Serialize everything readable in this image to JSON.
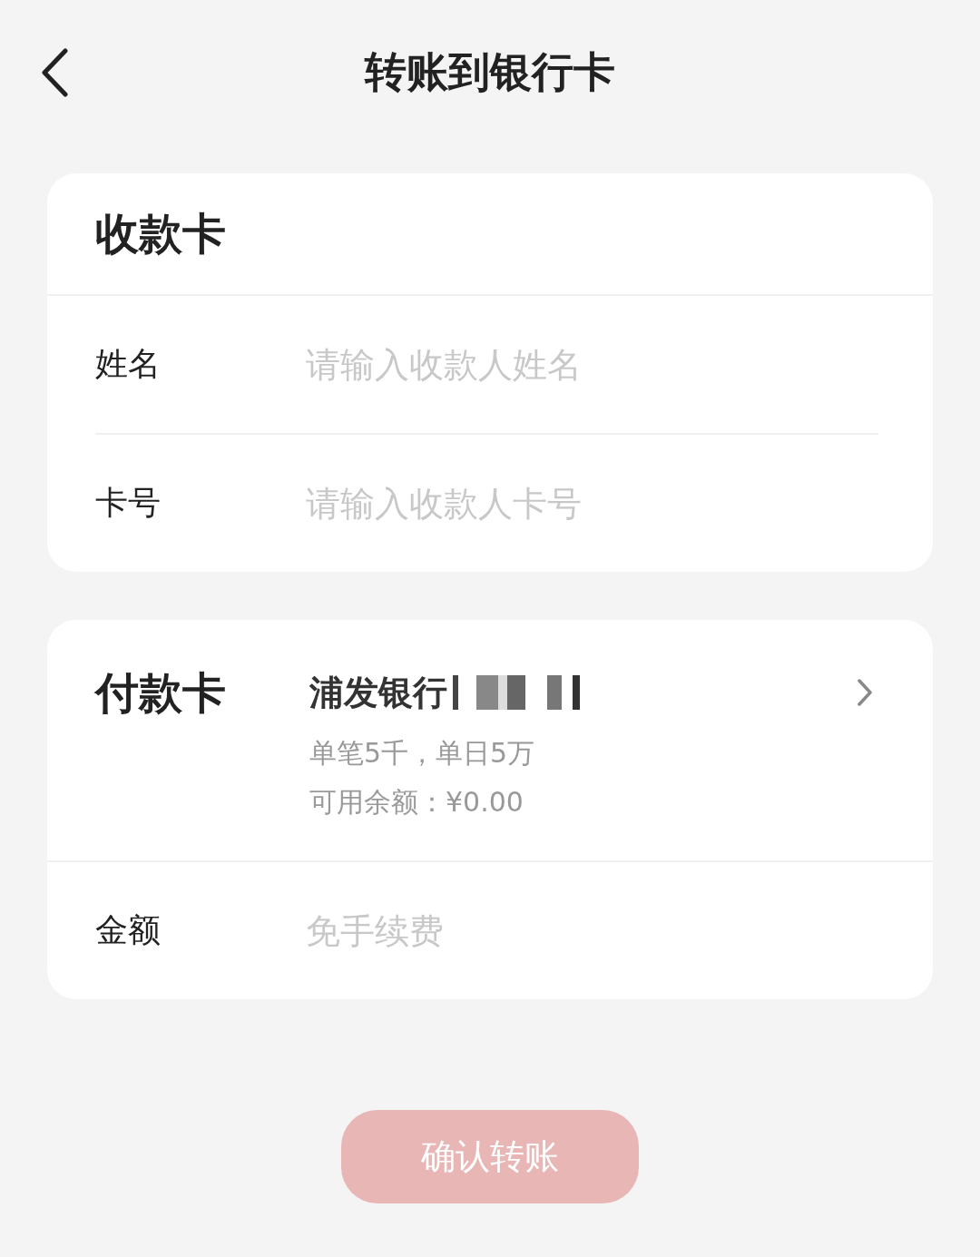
{
  "header": {
    "title": "转账到银行卡"
  },
  "receive_card": {
    "title": "收款卡",
    "fields": [
      {
        "label": "姓名",
        "placeholder": "请输入收款人姓名"
      },
      {
        "label": "卡号",
        "placeholder": "请输入收款人卡号"
      }
    ]
  },
  "pay_card": {
    "title": "付款卡",
    "bank_name": "浦发银行",
    "limits": "单笔5千，单日5万",
    "balance": "可用余额：¥0.00",
    "amount": {
      "label": "金额",
      "placeholder": "免手续费"
    }
  },
  "confirm_button": {
    "label": "确认转账",
    "disabled": true
  }
}
